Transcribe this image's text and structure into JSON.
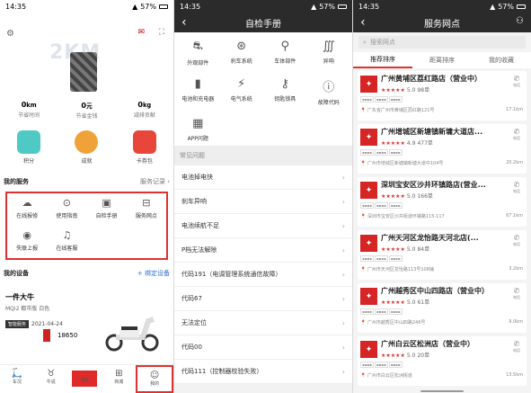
{
  "status": {
    "time": "14:35",
    "battery": "57%"
  },
  "p1": {
    "cloud": "2KM",
    "stats": [
      {
        "v": "0",
        "u": "km",
        "l": "节省时间"
      },
      {
        "v": "0",
        "u": "元",
        "l": "节省金钱"
      },
      {
        "v": "0",
        "u": "kg",
        "l": "减排贡献"
      }
    ],
    "badges": [
      {
        "l": "积分",
        "c": "#4ec9c4"
      },
      {
        "l": "成就",
        "c": "#f0a23a"
      },
      {
        "l": "卡券包",
        "c": "#e8463a"
      }
    ],
    "svc_title": "我的服务",
    "svc_more": "服务记录 ›",
    "svc": [
      "在线报修",
      "使用指南",
      "自检手册",
      "服务网点",
      "失联上报",
      "在线客服"
    ],
    "dev_title": "我的设备",
    "dev_bind": "+ 绑定设备",
    "dev_name": "一件大牛",
    "dev_model": "MQi2 都市版 白色",
    "dev_tag": "智能服务",
    "dev_date": "2021-04-24",
    "dev2": "18650",
    "nav": [
      "车况",
      "牛说",
      "GO",
      "商城",
      "我的"
    ]
  },
  "p2": {
    "title": "自检手册",
    "items": [
      "外观部件",
      "刹车系统",
      "车体部件",
      "异响",
      "电池和充电器",
      "电气系统",
      "钥匙锁具",
      "故障代码",
      "APP问题"
    ],
    "faq_title": "常见问题",
    "faq": [
      "电池掉电快",
      "刹车异响",
      "电池续航不足",
      "P档无法解除",
      "代码191（电调管理系统通信故障）",
      "代码67",
      "无法定位",
      "代码00",
      "代码111（控制器校验失败）"
    ]
  },
  "p3": {
    "title": "服务网点",
    "search": "搜索网点",
    "tabs": [
      "推荐排序",
      "距离排序",
      "我的收藏"
    ],
    "phone": "电话",
    "stores": [
      {
        "name": "广州黄埔区荔红路店（营业中）",
        "score": "5.0",
        "orders": "98单",
        "addr": "广东省广州市黄埔区荔红路121号",
        "dist": "17.1km"
      },
      {
        "name": "广州增城区新塘镇新墉大道店...",
        "score": "4.9",
        "orders": "477单",
        "addr": "广州市增城区新塘镇新塘大道中104号",
        "dist": "20.2km"
      },
      {
        "name": "深圳宝安区沙井环镇路店(营业...",
        "score": "5.0",
        "orders": "166单",
        "addr": "深圳市宝安区沙井街道环镇路115-117",
        "dist": "67.1km"
      },
      {
        "name": "广州天河区龙怡路天河北店(...",
        "score": "5.0",
        "orders": "84单",
        "addr": "广州市天河区龙怡路113号108铺",
        "dist": "3.2km"
      },
      {
        "name": "广州越秀区中山四路店（营业中）",
        "score": "5.0",
        "orders": "61单",
        "addr": "广州市越秀区中山四路246号",
        "dist": "9.0km"
      },
      {
        "name": "广州白云区松洲店（营业中）",
        "score": "5.0",
        "orders": "20单",
        "addr": "广州市白云区松洲街道",
        "dist": "13.5km"
      }
    ]
  }
}
